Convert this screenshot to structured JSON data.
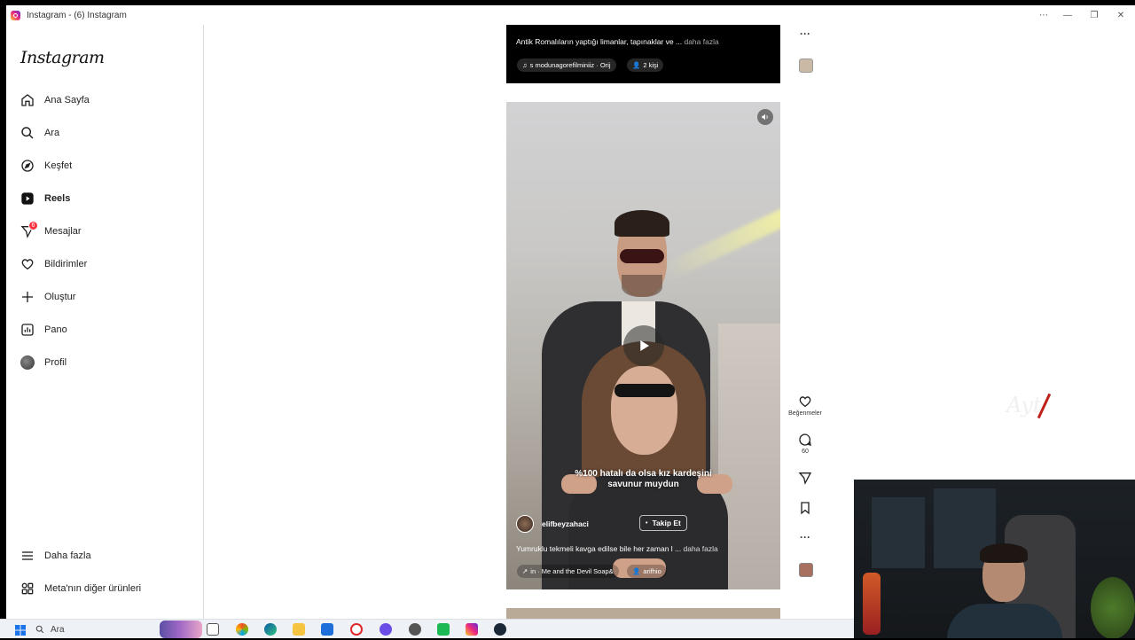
{
  "window": {
    "title": "Instagram - (6) Instagram",
    "controls": [
      "⋯",
      "—",
      "❐",
      "✕"
    ]
  },
  "sidebar": {
    "logo": "Instagram",
    "items": [
      {
        "label": "Ana Sayfa",
        "icon": "home-icon"
      },
      {
        "label": "Ara",
        "icon": "search-icon"
      },
      {
        "label": "Keşfet",
        "icon": "compass-icon"
      },
      {
        "label": "Reels",
        "icon": "reels-icon",
        "active": true
      },
      {
        "label": "Mesajlar",
        "icon": "messenger-icon",
        "badge": "6"
      },
      {
        "label": "Bildirimler",
        "icon": "heart-icon"
      },
      {
        "label": "Oluştur",
        "icon": "plus-icon"
      },
      {
        "label": "Pano",
        "icon": "dashboard-icon"
      },
      {
        "label": "Profil",
        "icon": "avatar"
      }
    ],
    "bottom": [
      {
        "label": "Daha fazla",
        "icon": "menu-icon"
      },
      {
        "label": "Meta'nın diğer ürünleri",
        "icon": "apps-grid-icon"
      }
    ]
  },
  "prev_post": {
    "caption": "Antik Romalıların yaptığı limanlar, tapınaklar ve ...",
    "more": "daha fazla",
    "audio": "s   modunagorefilminiiz · Orij",
    "people": "2 kişi"
  },
  "reel": {
    "overlay_text_line1": "%100 hatalı da olsa kız kardeşini",
    "overlay_text_line2": "savunur muydun",
    "username": "elifbeyzahaci",
    "follow_label": "Takip Et",
    "caption": "Yumruklu tekmeli kavga edilse bile her zaman l ...",
    "more": "daha fazla",
    "audio": "in · Me and the Devil  Soap&",
    "tagged": "arifhio"
  },
  "actions": {
    "likes_label": "Beğenmeler",
    "comments_count": "60"
  },
  "taskbar": {
    "search_placeholder": "Ara"
  },
  "colors": {
    "badge": "#ff3040",
    "sidebar_border": "#dbdbdb"
  }
}
